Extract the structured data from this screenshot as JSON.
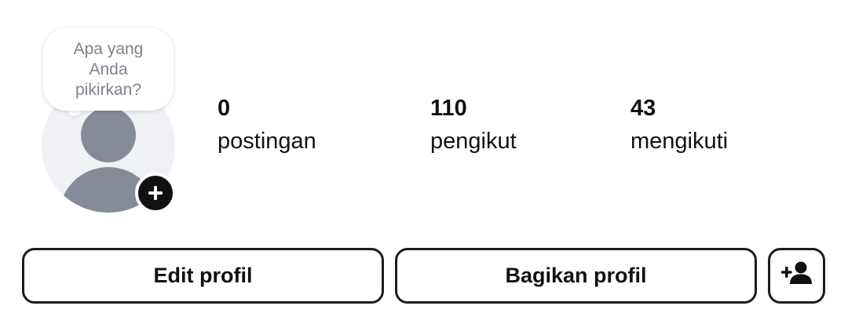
{
  "note": {
    "placeholder": "Apa yang Anda pikirkan?"
  },
  "profile": {
    "avatar_icon": "default-user-silhouette",
    "add_story_icon": "plus-icon"
  },
  "stats": {
    "posts": {
      "count": "0",
      "label": "postingan"
    },
    "followers": {
      "count": "110",
      "label": "pengikut"
    },
    "following": {
      "count": "43",
      "label": "mengikuti"
    }
  },
  "actions": {
    "edit_label": "Edit profil",
    "share_label": "Bagikan profil",
    "discover_icon": "add-person-icon"
  },
  "colors": {
    "accent": "#111111",
    "avatar_bg": "#f0f1f4",
    "avatar_silhouette": "#858b97",
    "note_text": "#7d838c"
  }
}
